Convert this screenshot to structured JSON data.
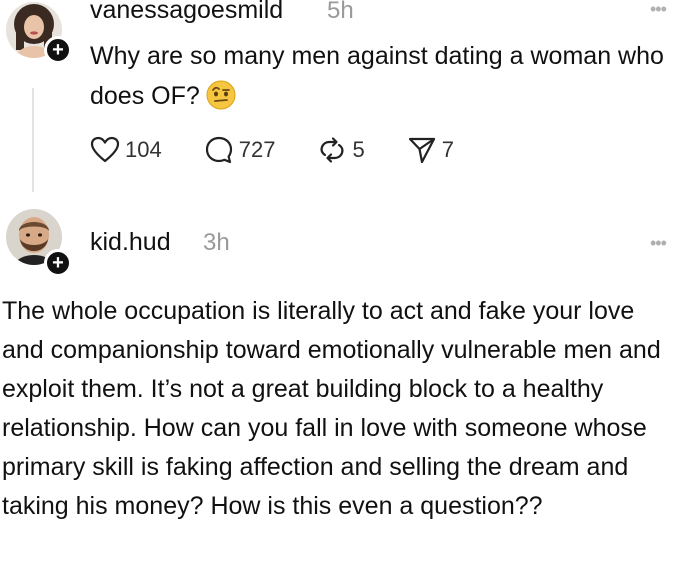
{
  "post": {
    "username": "vanessagoesmild",
    "time": "5h",
    "text": "Why are so many men against dating a woman who does OF?",
    "emoji": "raised-eyebrow-emoji",
    "plus": "+",
    "stats": {
      "likes": "104",
      "comments": "727",
      "reposts": "5",
      "shares": "7"
    }
  },
  "reply": {
    "username": "kid.hud",
    "time": "3h",
    "plus": "+",
    "text": "The whole occupation is literally to act and fake your love and companionship toward emotionally vulnerable men and exploit them. It’s not a great building block to a healthy relationship. How can you fall in love with someone whose primary skill is faking affection and selling the dream and taking his money? How is this even a question??"
  },
  "icons": {
    "more": "more-dots-icon",
    "like": "heart-icon",
    "comment": "comment-bubble-icon",
    "repost": "repost-icon",
    "share": "send-icon"
  },
  "colors": {
    "text": "#111111",
    "muted": "#9a9a9a",
    "badge": "#111111"
  }
}
